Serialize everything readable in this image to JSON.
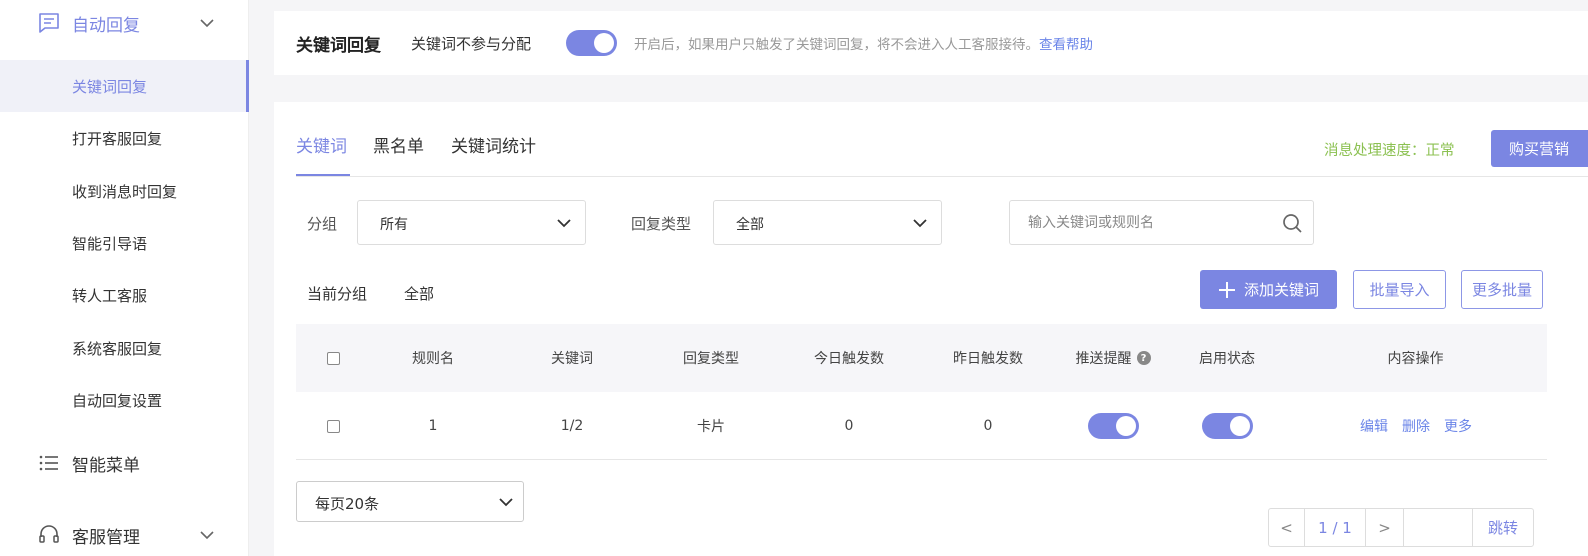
{
  "sidebar": {
    "groups": [
      {
        "label": "自动回复",
        "icon": "message-icon",
        "expanded": true
      },
      {
        "label": "智能菜单",
        "icon": "list-icon"
      },
      {
        "label": "客服管理",
        "icon": "headset-icon",
        "expanded": false
      }
    ],
    "items": [
      {
        "label": "关键词回复",
        "active": true
      },
      {
        "label": "打开客服回复"
      },
      {
        "label": "收到消息时回复"
      },
      {
        "label": "智能引导语"
      },
      {
        "label": "转人工客服"
      },
      {
        "label": "系统客服回复"
      },
      {
        "label": "自动回复设置"
      }
    ]
  },
  "banner": {
    "title": "关键词回复",
    "toggle_label": "关键词不参与分配",
    "toggle_on": true,
    "description": "开启后，如果用户只触发了关键词回复，将不会进入人工客服接待。",
    "help_link": "查看帮助"
  },
  "tabs": [
    {
      "label": "关键词",
      "active": true
    },
    {
      "label": "黑名单"
    },
    {
      "label": "关键词统计"
    }
  ],
  "speed_text": "消息处理速度：正常",
  "buy_button": "购买营销",
  "filters": {
    "group_label": "分组",
    "group_value": "所有",
    "reply_type_label": "回复类型",
    "reply_type_value": "全部",
    "search_placeholder": "输入关键词或规则名"
  },
  "sub_filters": {
    "current_group": "当前分组",
    "all": "全部"
  },
  "actions": {
    "add_keyword": "添加关键词",
    "batch_import": "批量导入",
    "more_batch": "更多批量"
  },
  "table": {
    "columns": [
      "规则名",
      "关键词",
      "回复类型",
      "今日触发数",
      "昨日触发数",
      "推送提醒",
      "启用状态",
      "内容操作"
    ],
    "rows": [
      {
        "rule": "1",
        "keyword": "1/2",
        "type": "卡片",
        "today": "0",
        "yesterday": "0",
        "push": true,
        "enabled": true
      }
    ],
    "ops": [
      "编辑",
      "删除",
      "更多"
    ]
  },
  "footer": {
    "page_size": "每页20条",
    "prev": "<",
    "page": "1 / 1",
    "next": ">",
    "jump": "跳转"
  },
  "colors": {
    "accent": "#7b86e2",
    "link": "#6b85e8",
    "status_ok": "#8cc152"
  }
}
